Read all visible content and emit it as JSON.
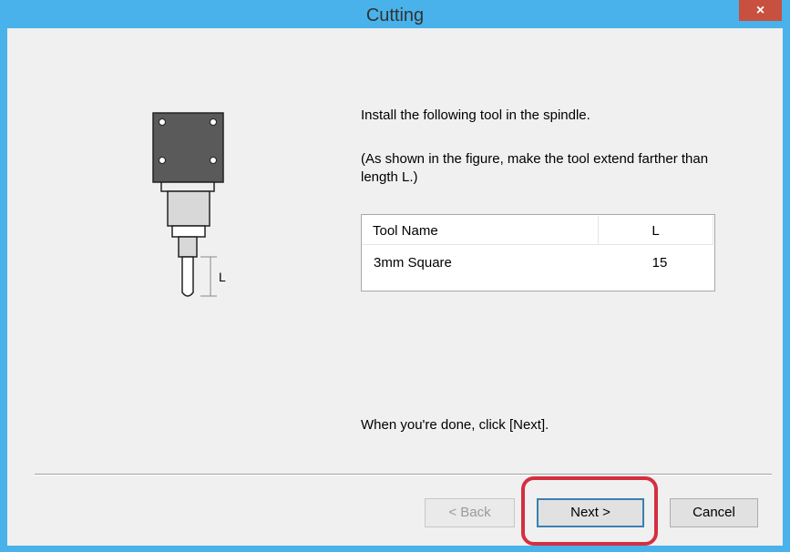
{
  "window": {
    "title": "Cutting",
    "close_glyph": "×"
  },
  "instructions": {
    "line1": "Install the following tool in the spindle.",
    "line2": "(As shown in the figure, make the tool extend farther than length L.)",
    "done": "When you're done, click [Next]."
  },
  "tool_table": {
    "columns": [
      "Tool Name",
      "L"
    ],
    "rows": [
      [
        "3mm Square",
        "15"
      ]
    ]
  },
  "figure": {
    "dimension_label": "L"
  },
  "buttons": {
    "back": "< Back",
    "next": "Next >",
    "cancel": "Cancel"
  },
  "colors": {
    "titlebar": "#49b2ea",
    "close_button": "#c7503f",
    "highlight": "#d42f3f"
  }
}
